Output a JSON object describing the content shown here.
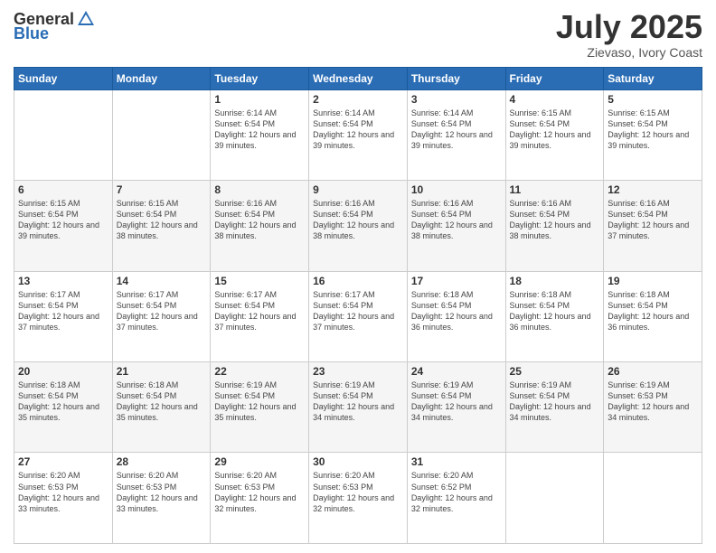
{
  "header": {
    "logo_general": "General",
    "logo_blue": "Blue",
    "month": "July 2025",
    "location": "Zievaso, Ivory Coast"
  },
  "calendar": {
    "days_of_week": [
      "Sunday",
      "Monday",
      "Tuesday",
      "Wednesday",
      "Thursday",
      "Friday",
      "Saturday"
    ],
    "weeks": [
      [
        {
          "day": "",
          "sunrise": "",
          "sunset": "",
          "daylight": ""
        },
        {
          "day": "",
          "sunrise": "",
          "sunset": "",
          "daylight": ""
        },
        {
          "day": "1",
          "sunrise": "Sunrise: 6:14 AM",
          "sunset": "Sunset: 6:54 PM",
          "daylight": "Daylight: 12 hours and 39 minutes."
        },
        {
          "day": "2",
          "sunrise": "Sunrise: 6:14 AM",
          "sunset": "Sunset: 6:54 PM",
          "daylight": "Daylight: 12 hours and 39 minutes."
        },
        {
          "day": "3",
          "sunrise": "Sunrise: 6:14 AM",
          "sunset": "Sunset: 6:54 PM",
          "daylight": "Daylight: 12 hours and 39 minutes."
        },
        {
          "day": "4",
          "sunrise": "Sunrise: 6:15 AM",
          "sunset": "Sunset: 6:54 PM",
          "daylight": "Daylight: 12 hours and 39 minutes."
        },
        {
          "day": "5",
          "sunrise": "Sunrise: 6:15 AM",
          "sunset": "Sunset: 6:54 PM",
          "daylight": "Daylight: 12 hours and 39 minutes."
        }
      ],
      [
        {
          "day": "6",
          "sunrise": "Sunrise: 6:15 AM",
          "sunset": "Sunset: 6:54 PM",
          "daylight": "Daylight: 12 hours and 39 minutes."
        },
        {
          "day": "7",
          "sunrise": "Sunrise: 6:15 AM",
          "sunset": "Sunset: 6:54 PM",
          "daylight": "Daylight: 12 hours and 38 minutes."
        },
        {
          "day": "8",
          "sunrise": "Sunrise: 6:16 AM",
          "sunset": "Sunset: 6:54 PM",
          "daylight": "Daylight: 12 hours and 38 minutes."
        },
        {
          "day": "9",
          "sunrise": "Sunrise: 6:16 AM",
          "sunset": "Sunset: 6:54 PM",
          "daylight": "Daylight: 12 hours and 38 minutes."
        },
        {
          "day": "10",
          "sunrise": "Sunrise: 6:16 AM",
          "sunset": "Sunset: 6:54 PM",
          "daylight": "Daylight: 12 hours and 38 minutes."
        },
        {
          "day": "11",
          "sunrise": "Sunrise: 6:16 AM",
          "sunset": "Sunset: 6:54 PM",
          "daylight": "Daylight: 12 hours and 38 minutes."
        },
        {
          "day": "12",
          "sunrise": "Sunrise: 6:16 AM",
          "sunset": "Sunset: 6:54 PM",
          "daylight": "Daylight: 12 hours and 37 minutes."
        }
      ],
      [
        {
          "day": "13",
          "sunrise": "Sunrise: 6:17 AM",
          "sunset": "Sunset: 6:54 PM",
          "daylight": "Daylight: 12 hours and 37 minutes."
        },
        {
          "day": "14",
          "sunrise": "Sunrise: 6:17 AM",
          "sunset": "Sunset: 6:54 PM",
          "daylight": "Daylight: 12 hours and 37 minutes."
        },
        {
          "day": "15",
          "sunrise": "Sunrise: 6:17 AM",
          "sunset": "Sunset: 6:54 PM",
          "daylight": "Daylight: 12 hours and 37 minutes."
        },
        {
          "day": "16",
          "sunrise": "Sunrise: 6:17 AM",
          "sunset": "Sunset: 6:54 PM",
          "daylight": "Daylight: 12 hours and 37 minutes."
        },
        {
          "day": "17",
          "sunrise": "Sunrise: 6:18 AM",
          "sunset": "Sunset: 6:54 PM",
          "daylight": "Daylight: 12 hours and 36 minutes."
        },
        {
          "day": "18",
          "sunrise": "Sunrise: 6:18 AM",
          "sunset": "Sunset: 6:54 PM",
          "daylight": "Daylight: 12 hours and 36 minutes."
        },
        {
          "day": "19",
          "sunrise": "Sunrise: 6:18 AM",
          "sunset": "Sunset: 6:54 PM",
          "daylight": "Daylight: 12 hours and 36 minutes."
        }
      ],
      [
        {
          "day": "20",
          "sunrise": "Sunrise: 6:18 AM",
          "sunset": "Sunset: 6:54 PM",
          "daylight": "Daylight: 12 hours and 35 minutes."
        },
        {
          "day": "21",
          "sunrise": "Sunrise: 6:18 AM",
          "sunset": "Sunset: 6:54 PM",
          "daylight": "Daylight: 12 hours and 35 minutes."
        },
        {
          "day": "22",
          "sunrise": "Sunrise: 6:19 AM",
          "sunset": "Sunset: 6:54 PM",
          "daylight": "Daylight: 12 hours and 35 minutes."
        },
        {
          "day": "23",
          "sunrise": "Sunrise: 6:19 AM",
          "sunset": "Sunset: 6:54 PM",
          "daylight": "Daylight: 12 hours and 34 minutes."
        },
        {
          "day": "24",
          "sunrise": "Sunrise: 6:19 AM",
          "sunset": "Sunset: 6:54 PM",
          "daylight": "Daylight: 12 hours and 34 minutes."
        },
        {
          "day": "25",
          "sunrise": "Sunrise: 6:19 AM",
          "sunset": "Sunset: 6:54 PM",
          "daylight": "Daylight: 12 hours and 34 minutes."
        },
        {
          "day": "26",
          "sunrise": "Sunrise: 6:19 AM",
          "sunset": "Sunset: 6:53 PM",
          "daylight": "Daylight: 12 hours and 34 minutes."
        }
      ],
      [
        {
          "day": "27",
          "sunrise": "Sunrise: 6:20 AM",
          "sunset": "Sunset: 6:53 PM",
          "daylight": "Daylight: 12 hours and 33 minutes."
        },
        {
          "day": "28",
          "sunrise": "Sunrise: 6:20 AM",
          "sunset": "Sunset: 6:53 PM",
          "daylight": "Daylight: 12 hours and 33 minutes."
        },
        {
          "day": "29",
          "sunrise": "Sunrise: 6:20 AM",
          "sunset": "Sunset: 6:53 PM",
          "daylight": "Daylight: 12 hours and 32 minutes."
        },
        {
          "day": "30",
          "sunrise": "Sunrise: 6:20 AM",
          "sunset": "Sunset: 6:53 PM",
          "daylight": "Daylight: 12 hours and 32 minutes."
        },
        {
          "day": "31",
          "sunrise": "Sunrise: 6:20 AM",
          "sunset": "Sunset: 6:52 PM",
          "daylight": "Daylight: 12 hours and 32 minutes."
        },
        {
          "day": "",
          "sunrise": "",
          "sunset": "",
          "daylight": ""
        },
        {
          "day": "",
          "sunrise": "",
          "sunset": "",
          "daylight": ""
        }
      ]
    ]
  }
}
